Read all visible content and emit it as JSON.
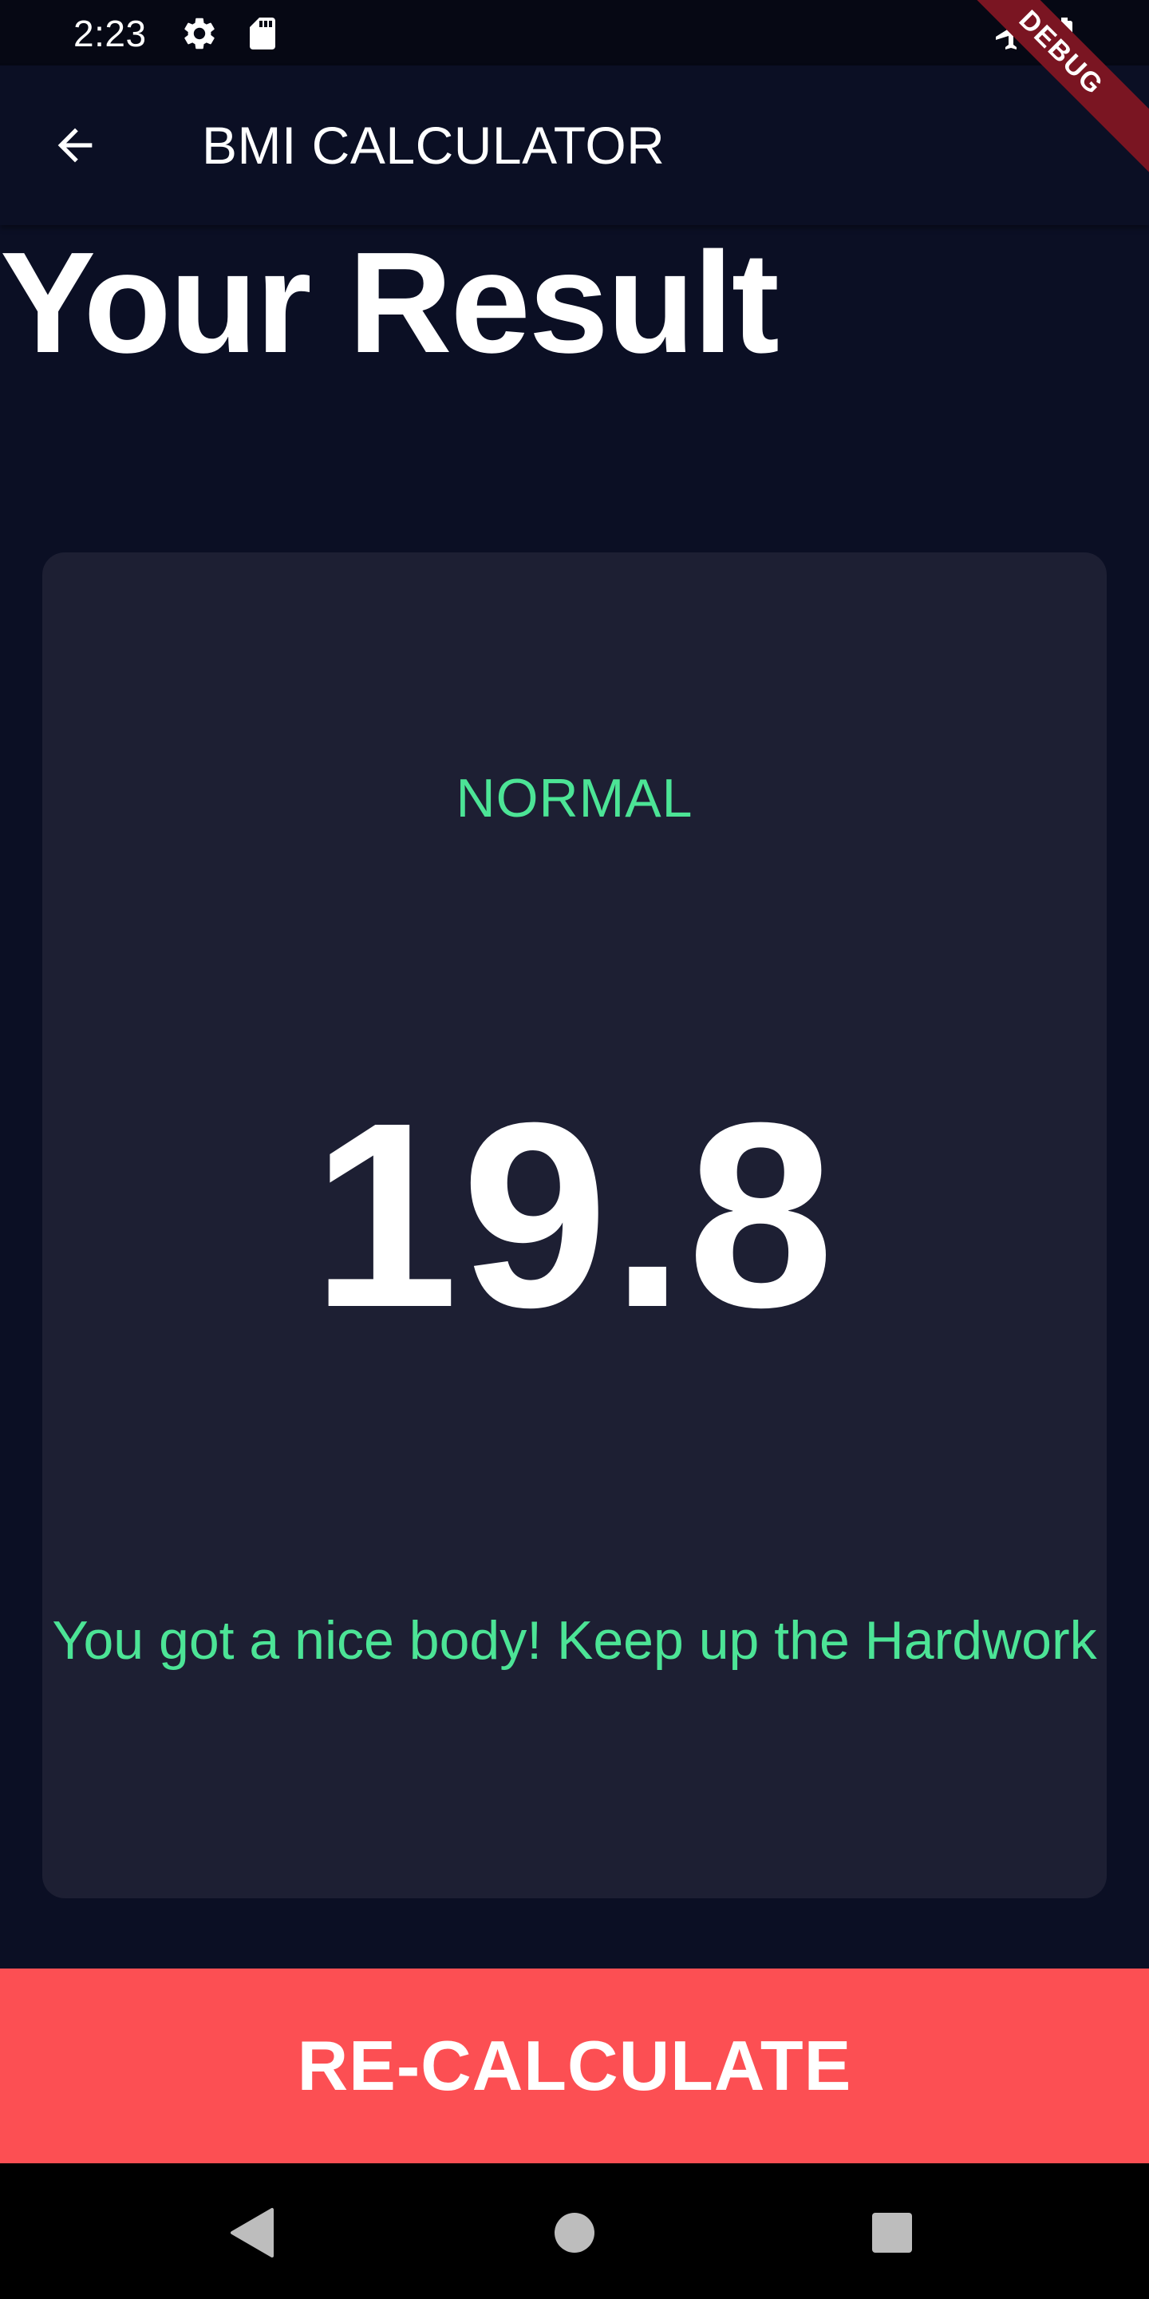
{
  "status_bar": {
    "time": "2:23",
    "icons": [
      "settings-icon",
      "sd-card-icon",
      "airplane-mode-icon",
      "battery-icon"
    ]
  },
  "debug_banner": {
    "label": "DEBUG",
    "color": "#7a1522"
  },
  "app_bar": {
    "back_icon": "arrow-back-icon",
    "title": "BMI CALCULATOR"
  },
  "page": {
    "heading": "Your Result"
  },
  "result": {
    "status": "NORMAL",
    "bmi_value": "19.8",
    "message": "You got a nice body! Keep up the Hardwork"
  },
  "actions": {
    "recalculate_label": "RE-CALCULATE"
  },
  "nav_bar": {
    "buttons": [
      "back-triangle-icon",
      "home-circle-icon",
      "recents-square-icon"
    ]
  },
  "colors": {
    "background": "#0b0f24",
    "card": "#1d1f33",
    "accent_green": "#4ce496",
    "button_red": "#fc4f53",
    "text": "#ffffff"
  }
}
